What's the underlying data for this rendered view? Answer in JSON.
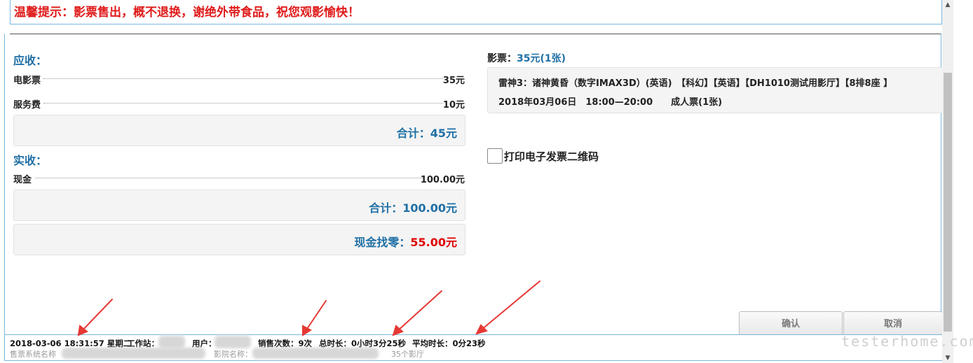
{
  "notice": "温馨提示：影票售出，概不退换，谢绝外带食品，祝您观影愉快！",
  "receivable": {
    "title": "应收：",
    "items": [
      {
        "label": "电影票",
        "value": "35元"
      },
      {
        "label": "服务费",
        "value": "10元"
      }
    ],
    "total_label": "合计：",
    "total_value": "45元"
  },
  "received": {
    "title": "实收：",
    "items": [
      {
        "label": "现金",
        "value": "100.00元"
      }
    ],
    "total_label": "合计：",
    "total_value": "100.00元",
    "change_label": "现金找零：",
    "change_value": "55.00元"
  },
  "ticket": {
    "label": "影票：",
    "summary": "35元(1张)",
    "line1": "雷神3：诸神黄昏（数字IMAX3D）(英语)　【科幻】【英语】【DH1010测试用影厅】【8排8座 】",
    "line2": "2018年03月06日　18:00—20:00　　成人票(1张)"
  },
  "invoice": {
    "label": "打印电子发票二维码",
    "checked": false
  },
  "buttons": {
    "confirm": "确认",
    "cancel": "取消"
  },
  "status": {
    "datetime": "2018-03-06 18:31:57 星期二",
    "workstation_label": "工作站：",
    "user_label": "用户：",
    "sales_count": "销售次数：9次",
    "total_time": "总时长：0小时3分25秒",
    "avg_time": "平均时长：0分23秒",
    "system_label": "售票系统名称",
    "cinema_label": "影院名称：",
    "halls": "35个影厅"
  },
  "watermark": "testerhome.com",
  "colors": {
    "accent": "#1f6fa5",
    "notice": "#e01b1b",
    "change": "#e00000",
    "border": "#7ab8e0"
  }
}
